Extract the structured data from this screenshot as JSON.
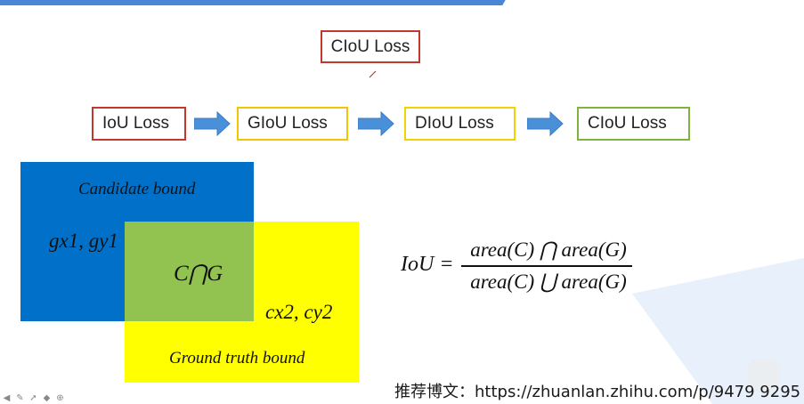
{
  "header": {
    "title": "CIoU Loss"
  },
  "flow": {
    "steps": [
      {
        "label": "IoU Loss"
      },
      {
        "label": "GIoU Loss"
      },
      {
        "label": "DIoU Loss"
      },
      {
        "label": "CIoU Loss"
      }
    ]
  },
  "diagram": {
    "candidate_label": "Candidate bound",
    "candidate_coords": "gx1, gy1",
    "intersection_label": "C⋂G",
    "ground_coords": "cx2, cy2",
    "ground_label": "Ground truth bound",
    "colors": {
      "candidate": "#0070c8",
      "ground": "#ffff00",
      "intersection": "#92c350"
    }
  },
  "formula": {
    "lhs": "IoU =",
    "numerator": "area(C) ⋂ area(G)",
    "denominator": "area(C) ⋃ area(G)"
  },
  "watermark": {
    "text": "推荐博文：https://zhuanlan.zhihu.com/p/9479 9295"
  },
  "toolbar": {
    "icons": [
      "play-icon",
      "pen-icon",
      "pointer-icon",
      "eraser-icon",
      "zoom-icon"
    ]
  }
}
